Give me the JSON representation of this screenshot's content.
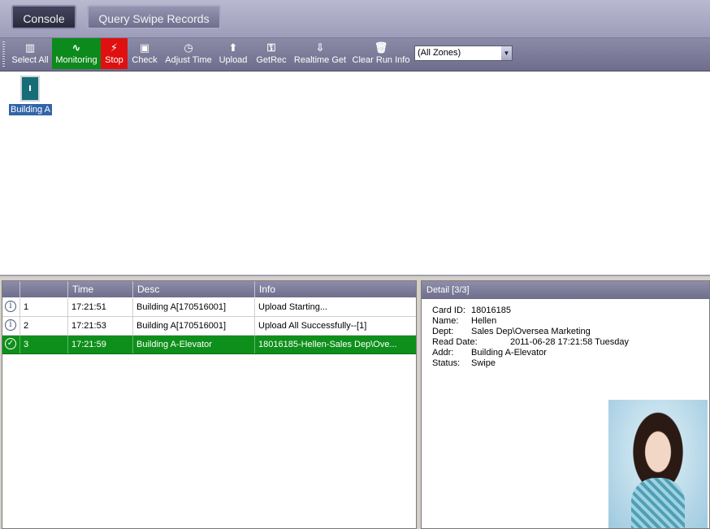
{
  "tabs": [
    {
      "label": "Console",
      "active": true
    },
    {
      "label": "Query Swipe Records",
      "active": false
    }
  ],
  "toolbar": {
    "buttons": [
      {
        "label": "Select All",
        "icon": "select-all-icon"
      },
      {
        "label": "Monitoring",
        "icon": "monitoring-icon",
        "state": "active",
        "color": "#0d8a1c"
      },
      {
        "label": "Stop",
        "icon": "stop-icon",
        "color": "#e01010"
      },
      {
        "label": "Check",
        "icon": "check-icon"
      },
      {
        "label": "Adjust Time",
        "icon": "clock-icon"
      },
      {
        "label": "Upload",
        "icon": "upload-arrow-icon"
      },
      {
        "label": "GetRec",
        "icon": "get-record-icon"
      },
      {
        "label": "Realtime Get",
        "icon": "realtime-get-icon"
      },
      {
        "label": "Clear Run Info",
        "icon": "trash-icon"
      }
    ],
    "zone_select": {
      "value": "(All Zones)"
    }
  },
  "devices": [
    {
      "label": "Building A",
      "icon": "door-icon",
      "selected": true
    }
  ],
  "log": {
    "columns": [
      "",
      "",
      "Time",
      "Desc",
      "Info"
    ],
    "rows": [
      {
        "icon": "info-icon",
        "index": "1",
        "time": "17:21:51",
        "desc": "Building A[170516001]",
        "info": "Upload Starting...",
        "selected": false
      },
      {
        "icon": "info-icon",
        "index": "2",
        "time": "17:21:53",
        "desc": "Building A[170516001]",
        "info": "Upload All Successfully--[1]",
        "selected": false
      },
      {
        "icon": "check-circle-icon",
        "index": "3",
        "time": "17:21:59",
        "desc": "Building A-Elevator",
        "info": "18016185-Hellen-Sales Dep\\Ove...",
        "selected": true
      }
    ]
  },
  "detail": {
    "title": "Detail  [3/3]",
    "fields": [
      {
        "key": "Card ID:",
        "value": "18016185"
      },
      {
        "key": "Name:",
        "value": "Hellen"
      },
      {
        "key": "Dept:",
        "value": "Sales Dep\\Oversea Marketing"
      },
      {
        "key": "Read Date:",
        "value": "2011-06-28 17:21:58 Tuesday"
      },
      {
        "key": "Addr:",
        "value": "Building A-Elevator"
      },
      {
        "key": "Status:",
        "value": "Swipe"
      }
    ]
  },
  "colors": {
    "selected_row": "#0e8f1b",
    "monitoring": "#0d8a1c",
    "stop": "#e01010",
    "toolbar": "#7a7a98"
  }
}
